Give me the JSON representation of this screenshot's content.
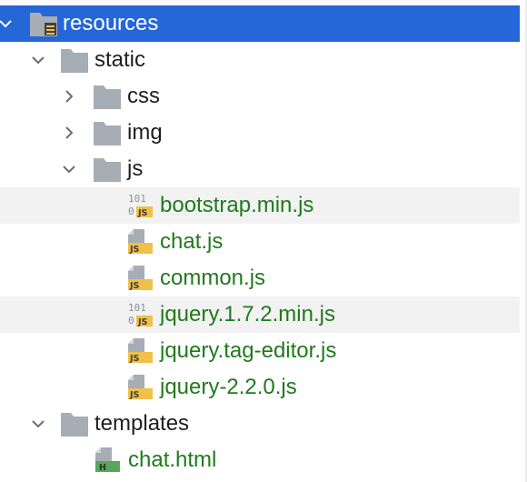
{
  "project_tree": {
    "nodes": [
      {
        "label": "resources",
        "expanded": true,
        "selected": true,
        "icon": "resources-folder-icon"
      },
      {
        "label": "static",
        "expanded": true,
        "icon": "folder-icon"
      },
      {
        "label": "css",
        "expanded": false,
        "icon": "folder-icon"
      },
      {
        "label": "img",
        "expanded": false,
        "icon": "folder-icon"
      },
      {
        "label": "js",
        "expanded": true,
        "icon": "folder-icon"
      },
      {
        "label": "bootstrap.min.js",
        "icon": "minified-js-file-icon"
      },
      {
        "label": "chat.js",
        "icon": "js-file-icon"
      },
      {
        "label": "common.js",
        "icon": "js-file-icon"
      },
      {
        "label": "jquery.1.7.2.min.js",
        "icon": "minified-js-file-icon"
      },
      {
        "label": "jquery.tag-editor.js",
        "icon": "js-file-icon"
      },
      {
        "label": "jquery-2.2.0.js",
        "icon": "js-file-icon"
      },
      {
        "label": "templates",
        "expanded": true,
        "icon": "folder-icon"
      },
      {
        "label": "chat.html",
        "icon": "html-file-icon"
      }
    ]
  },
  "icon_text": {
    "js_badge": "JS",
    "binary_digits_top": "101",
    "binary_digits_bottom": "0",
    "html_badge": "H"
  },
  "colors": {
    "selection": "#2566d8",
    "file_text": "#207a1c",
    "folder_gray": "#a7adb4",
    "js_badge": "#f0c049",
    "html_badge": "#5ba55b",
    "row_shade": "#f2f2f2"
  }
}
